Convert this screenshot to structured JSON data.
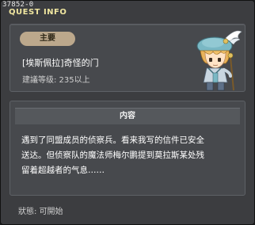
{
  "window": {
    "quest_id": "37852-0",
    "title": "QUEST INFO"
  },
  "quest": {
    "category": "主要",
    "name": "[埃斯佩拉]奇怪的门",
    "level_requirement": "建議等级: 235以上"
  },
  "content": {
    "header": "内容",
    "lines": [
      "遇到了同盟成员的侦察兵。看来我写的信件已安全",
      "送达。但侦察队的魔法师梅尔鹏提到莫拉斯某处残",
      "留着超越者的气息……"
    ]
  },
  "status": {
    "text": "狀態: 可開始"
  },
  "colors": {
    "badge": "#bca88c",
    "title": "#f0e6a0",
    "panel": "#47494d",
    "window": "#3c3d40"
  },
  "icons": {
    "portrait": "npc-portrait-icon"
  }
}
